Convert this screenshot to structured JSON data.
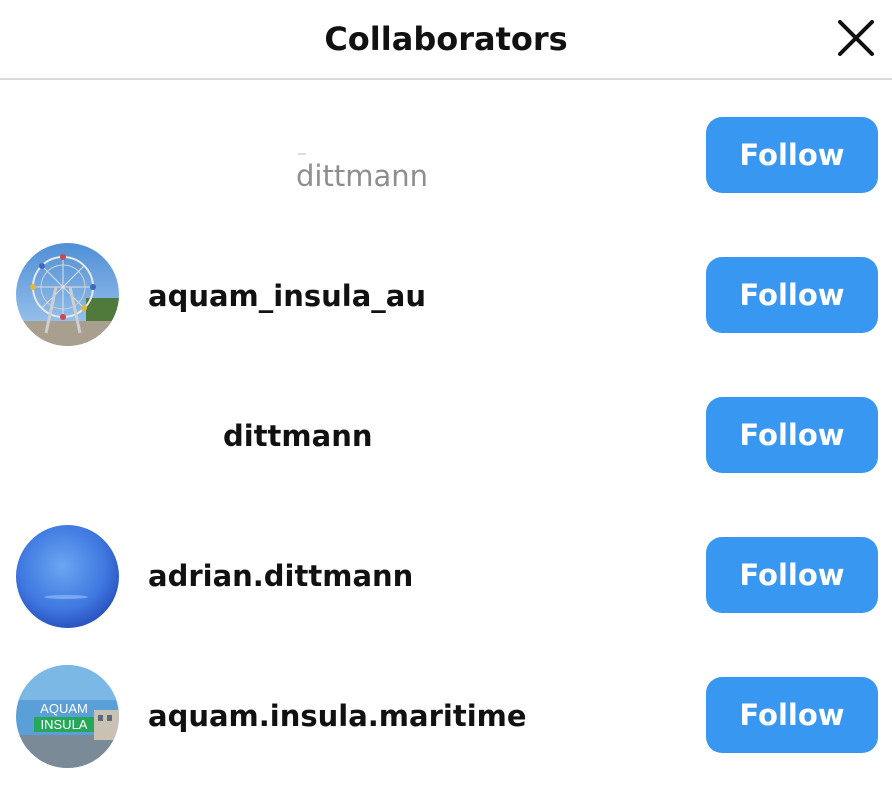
{
  "dialog": {
    "title": "Collaborators",
    "close_icon": "close-icon"
  },
  "collaborators": [
    {
      "username": "dittmann",
      "avatar": "broken-image",
      "follow_label": "Follow"
    },
    {
      "username": "aquam_insula_au",
      "avatar": "ferris-wheel-photo",
      "follow_label": "Follow"
    },
    {
      "username": "dittmann",
      "avatar": "none",
      "follow_label": "Follow"
    },
    {
      "username": "adrian.dittmann",
      "avatar": "blue-sky-photo",
      "follow_label": "Follow"
    },
    {
      "username": "aquam.insula.maritime",
      "avatar": "aquam-insula-logo",
      "follow_label": "Follow",
      "logo_text": [
        "AQUAM",
        "INSULA"
      ]
    }
  ],
  "colors": {
    "follow_button": "#3897f0",
    "follow_text": "#ffffff",
    "divider": "#dbdbdb",
    "muted_text": "#8e8e8e"
  }
}
